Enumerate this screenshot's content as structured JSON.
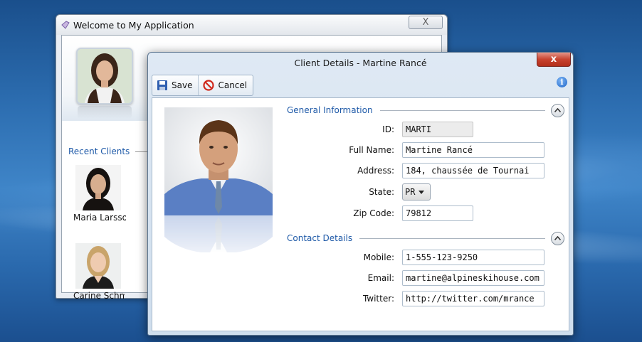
{
  "back_window": {
    "title": "Welcome to My Application",
    "close_glyph": "X",
    "recent_clients_label": "Recent Clients",
    "recent_clients": [
      {
        "name": "Maria Larsso"
      },
      {
        "name": "Carine Schmi"
      }
    ]
  },
  "dialog": {
    "title": "Client Details - Martine Rancé",
    "close_glyph": "x",
    "toolbar": {
      "save_label": "Save",
      "cancel_label": "Cancel"
    },
    "info_glyph": "i",
    "general": {
      "label": "General Information",
      "id_label": "ID:",
      "id_value": "MARTI",
      "fullname_label": "Full Name:",
      "fullname_value": "Martine Rancé",
      "address_label": "Address:",
      "address_value": "184, chaussée de Tournai",
      "state_label": "State:",
      "state_value": "PR",
      "zip_label": "Zip Code:",
      "zip_value": "79812"
    },
    "contact": {
      "label": "Contact Details",
      "mobile_label": "Mobile:",
      "mobile_value": "1-555-123-9250",
      "email_label": "Email:",
      "email_value": "martine@alpineskihouse.com",
      "twitter_label": "Twitter:",
      "twitter_value": "http://twitter.com/mrance"
    }
  },
  "colors": {
    "accent": "#1f5aa8",
    "close_red": "#c8432f"
  }
}
